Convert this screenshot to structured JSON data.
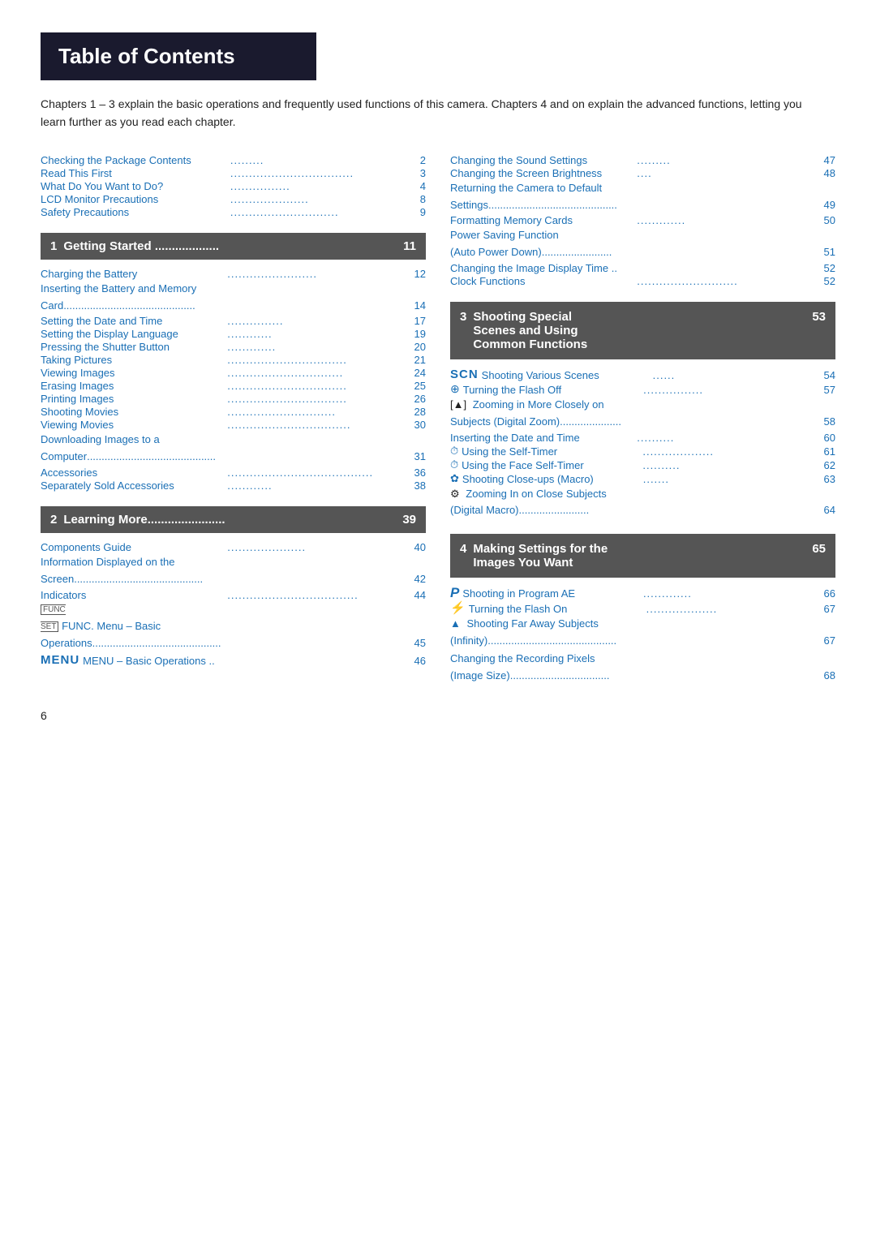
{
  "page": {
    "title": "Table of Contents",
    "intro": "Chapters 1 – 3 explain the basic operations and frequently used functions of this camera. Chapters 4 and on explain the advanced functions, letting you learn further as you read each chapter.",
    "page_number": "6"
  },
  "left_col": {
    "entries_top": [
      {
        "label": "Checking the Package Contents",
        "dots": ".......",
        "num": "2"
      },
      {
        "label": "Read This First",
        "dots": ".................................",
        "num": "3"
      },
      {
        "label": "What Do You Want to Do?",
        "dots": "...............",
        "num": "4"
      },
      {
        "label": "LCD Monitor Precautions",
        "dots": "..................",
        "num": "8"
      },
      {
        "label": "Safety Precautions",
        "dots": "............................",
        "num": "9"
      }
    ],
    "section1": {
      "num": "1",
      "title": "Getting Started",
      "dots": "...................",
      "page": "11"
    },
    "section1_entries": [
      {
        "label": "Charging the Battery",
        "dots": ".........................",
        "num": "12",
        "multiline": false
      },
      {
        "label": "Inserting the Battery and Memory Card",
        "dots": "...........................................",
        "num": "14",
        "multiline": true,
        "line1": "Inserting the Battery and Memory",
        "line2": "Card"
      },
      {
        "label": "Setting the Date and Time",
        "dots": "...............",
        "num": "17",
        "multiline": false
      },
      {
        "label": "Setting the Display Language",
        "dots": "..........",
        "num": "19",
        "multiline": false
      },
      {
        "label": "Pressing the Shutter Button",
        "dots": "..............",
        "num": "20",
        "multiline": false
      },
      {
        "label": "Taking Pictures",
        "dots": "...............................",
        "num": "21",
        "multiline": false
      },
      {
        "label": "Viewing Images",
        "dots": "..............................",
        "num": "24",
        "multiline": false
      },
      {
        "label": "Erasing Images",
        "dots": "...............................",
        "num": "25",
        "multiline": false
      },
      {
        "label": "Printing Images",
        "dots": "...............................",
        "num": "26",
        "multiline": false
      },
      {
        "label": "Shooting Movies",
        "dots": "............................",
        "num": "28",
        "multiline": false
      },
      {
        "label": "Viewing Movies",
        "dots": "..............................",
        "num": "30",
        "multiline": false
      },
      {
        "label": "Downloading Images to a Computer",
        "dots": "........................................",
        "num": "31",
        "multiline": true,
        "line1": "Downloading Images to a",
        "line2": "Computer"
      },
      {
        "label": "Accessories",
        "dots": "....................................",
        "num": "36",
        "multiline": false
      },
      {
        "label": "Separately Sold Accessories",
        "dots": "...........",
        "num": "38",
        "multiline": false
      }
    ],
    "section2": {
      "num": "2",
      "title": "Learning More",
      "dots": ".....................",
      "page": "39"
    },
    "section2_entries": [
      {
        "label": "Components Guide",
        "dots": "...................",
        "num": "40",
        "multiline": false
      },
      {
        "label": "Information Displayed on the Screen",
        "dots": "........................................",
        "num": "42",
        "multiline": true,
        "line1": "Information Displayed on the",
        "line2": "Screen"
      },
      {
        "label": "Indicators",
        "dots": "...............................",
        "num": "44",
        "multiline": false
      },
      {
        "label": "FUNC. Menu – Basic Operations",
        "dots": "...............................",
        "num": "45",
        "multiline": true,
        "line1": "FUNC. Menu – Basic",
        "line2": "Operations",
        "has_icon": true
      },
      {
        "label": "MENU – Basic Operations",
        "dots": "..",
        "num": "46",
        "multiline": false,
        "has_menu": true
      }
    ]
  },
  "right_col": {
    "entries_top": [
      {
        "label": "Changing the Sound Settings",
        "dots": ".........",
        "num": "47"
      },
      {
        "label": "Changing the Screen Brightness",
        "dots": "....",
        "num": "48"
      },
      {
        "label": "Returning the Camera to Default Settings",
        "dots": "..........................................",
        "num": "49",
        "multiline": true,
        "line1": "Returning the Camera to Default",
        "line2": "Settings"
      },
      {
        "label": "Formatting Memory Cards",
        "dots": "...............",
        "num": "50"
      },
      {
        "label": "Power Saving Function (Auto Power Down)",
        "dots": ".........................",
        "num": "51",
        "multiline": true,
        "line1": "Power Saving Function",
        "line2": "(Auto Power Down)"
      },
      {
        "label": "Changing the Image Display Time",
        "dots": "..",
        "num": "52"
      },
      {
        "label": "Clock Functions",
        "dots": "..............................",
        "num": "52"
      }
    ],
    "section3": {
      "num": "3",
      "title_line1": "Shooting Special",
      "title_line2": "Scenes and Using",
      "title_line3": "Common Functions",
      "page": "53"
    },
    "section3_entries": [
      {
        "icon": "SCN",
        "icon_type": "scn",
        "label": "Shooting Various Scenes",
        "dots": "......",
        "num": "54"
      },
      {
        "icon": "⊕",
        "icon_type": "circle",
        "label": "Turning the Flash Off",
        "dots": "................",
        "num": "57"
      },
      {
        "icon": "▲",
        "icon_type": "zoom",
        "label": "Zooming in More Closely on Subjects (Digital Zoom)",
        "dots": "...................",
        "num": "58",
        "multiline": true,
        "line1": "Zooming in More Closely on",
        "line2": "Subjects (Digital Zoom)"
      },
      {
        "icon": "",
        "icon_type": "none",
        "label": "Inserting the Date and Time",
        "dots": "..........",
        "num": "60"
      },
      {
        "icon": "⏱",
        "icon_type": "timer",
        "label": "Using the Self-Timer",
        "dots": "...................",
        "num": "61"
      },
      {
        "icon": "⏱",
        "icon_type": "face_timer",
        "label": "Using the Face Self-Timer",
        "dots": "..........",
        "num": "62"
      },
      {
        "icon": "✿",
        "icon_type": "macro",
        "label": "Shooting Close-ups (Macro)",
        "dots": ".......",
        "num": "63"
      },
      {
        "icon": "⚙",
        "icon_type": "digital_macro",
        "label": "Zooming In on Close Subjects (Digital Macro)",
        "dots": "...............................",
        "num": "64",
        "multiline": true,
        "line1": "Zooming In on Close Subjects",
        "line2": "(Digital Macro)"
      }
    ],
    "section4": {
      "num": "4",
      "title_line1": "Making Settings for the",
      "title_line2": "Images You Want",
      "page": "65"
    },
    "section4_entries": [
      {
        "icon": "P",
        "icon_type": "p",
        "label": "Shooting in Program AE",
        "dots": ".............",
        "num": "66"
      },
      {
        "icon": "⚡",
        "icon_type": "flash",
        "label": "Turning the Flash On",
        "dots": "...................",
        "num": "67"
      },
      {
        "icon": "▲",
        "icon_type": "mountain",
        "label": "Shooting Far Away Subjects (Infinity)",
        "dots": "..........................................",
        "num": "67",
        "multiline": true,
        "line1": "Shooting Far Away Subjects",
        "line2": "(Infinity)"
      },
      {
        "icon": "",
        "icon_type": "none",
        "label": "Changing the Recording Pixels (Image Size)",
        "dots": "....................................",
        "num": "68",
        "multiline": true,
        "line1": "Changing the Recording Pixels",
        "line2": "(Image Size)"
      }
    ]
  }
}
